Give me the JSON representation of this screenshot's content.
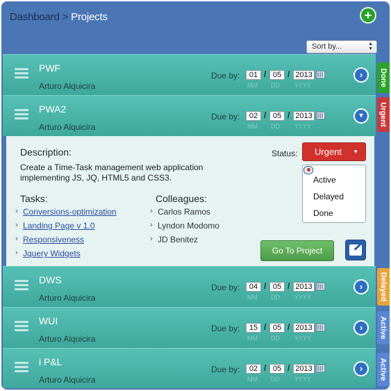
{
  "header": {
    "breadcrumb": [
      "Dashboard",
      ">",
      "Projects"
    ],
    "sort_label": "Sort by..."
  },
  "labels": {
    "due_by": "Due by:",
    "mm": "MM",
    "dd": "DD",
    "yyyy": "YYYY"
  },
  "projects": [
    {
      "name": "PWF",
      "owner": "Arturo Alquicira",
      "month": "01",
      "day": "05",
      "year": "2013",
      "status": "Done",
      "status_color": "#2aa42b",
      "expanded": false
    },
    {
      "name": "PWA2",
      "owner": "Arturo Alquicira",
      "month": "02",
      "day": "05",
      "year": "2013",
      "status": "Urgent",
      "status_color": "#c63a3a",
      "expanded": true
    },
    {
      "name": "DWS",
      "owner": "Arturo Alquicira",
      "month": "04",
      "day": "05",
      "year": "2013",
      "status": "Delayed",
      "status_color": "#e8a33c",
      "expanded": false
    },
    {
      "name": "WUI",
      "owner": "Arturo Alquicira",
      "month": "15",
      "day": "05",
      "year": "2013",
      "status": "Active",
      "status_color": "#5a86d2",
      "expanded": false
    },
    {
      "name": "i P&L",
      "owner": "Arturo Alquicira",
      "month": "02",
      "day": "05",
      "year": "2013",
      "status": "Active",
      "status_color": "#5a86d2",
      "expanded": false
    }
  ],
  "detail": {
    "description_label": "Description:",
    "description": "Create a Time-Task management web application implementing JS, JQ, HTML5 and CSS3.",
    "status_label": "Status:",
    "status_value": "Urgent",
    "status_options": [
      "Active",
      "Delayed",
      "Done"
    ],
    "tasks_label": "Tasks:",
    "tasks": [
      "Conversions-optimization",
      "Landing Page v 1.0",
      "Responsiveness",
      "Jquery Widgets"
    ],
    "colleagues_label": "Colleagues:",
    "colleagues": [
      "Carlos Ramos",
      "Lyndon Modomo",
      "JD Benitez"
    ],
    "goto_label": "Go To Project",
    "bullet": "›"
  },
  "icons": {
    "add": "plus-circle-icon",
    "menu": "hamburger-icon",
    "open": "chevron-right-circle-icon",
    "collapse": "chevron-down-circle-icon",
    "calendar": "calendar-icon",
    "edit": "edit-icon",
    "visibility": "eye-icon"
  },
  "colors": {
    "frame": "#4a76b6",
    "row": "#4db5ab",
    "detail_bg": "#e6f3f1",
    "urgent": "#d0312d",
    "goto": "#5aa954"
  }
}
